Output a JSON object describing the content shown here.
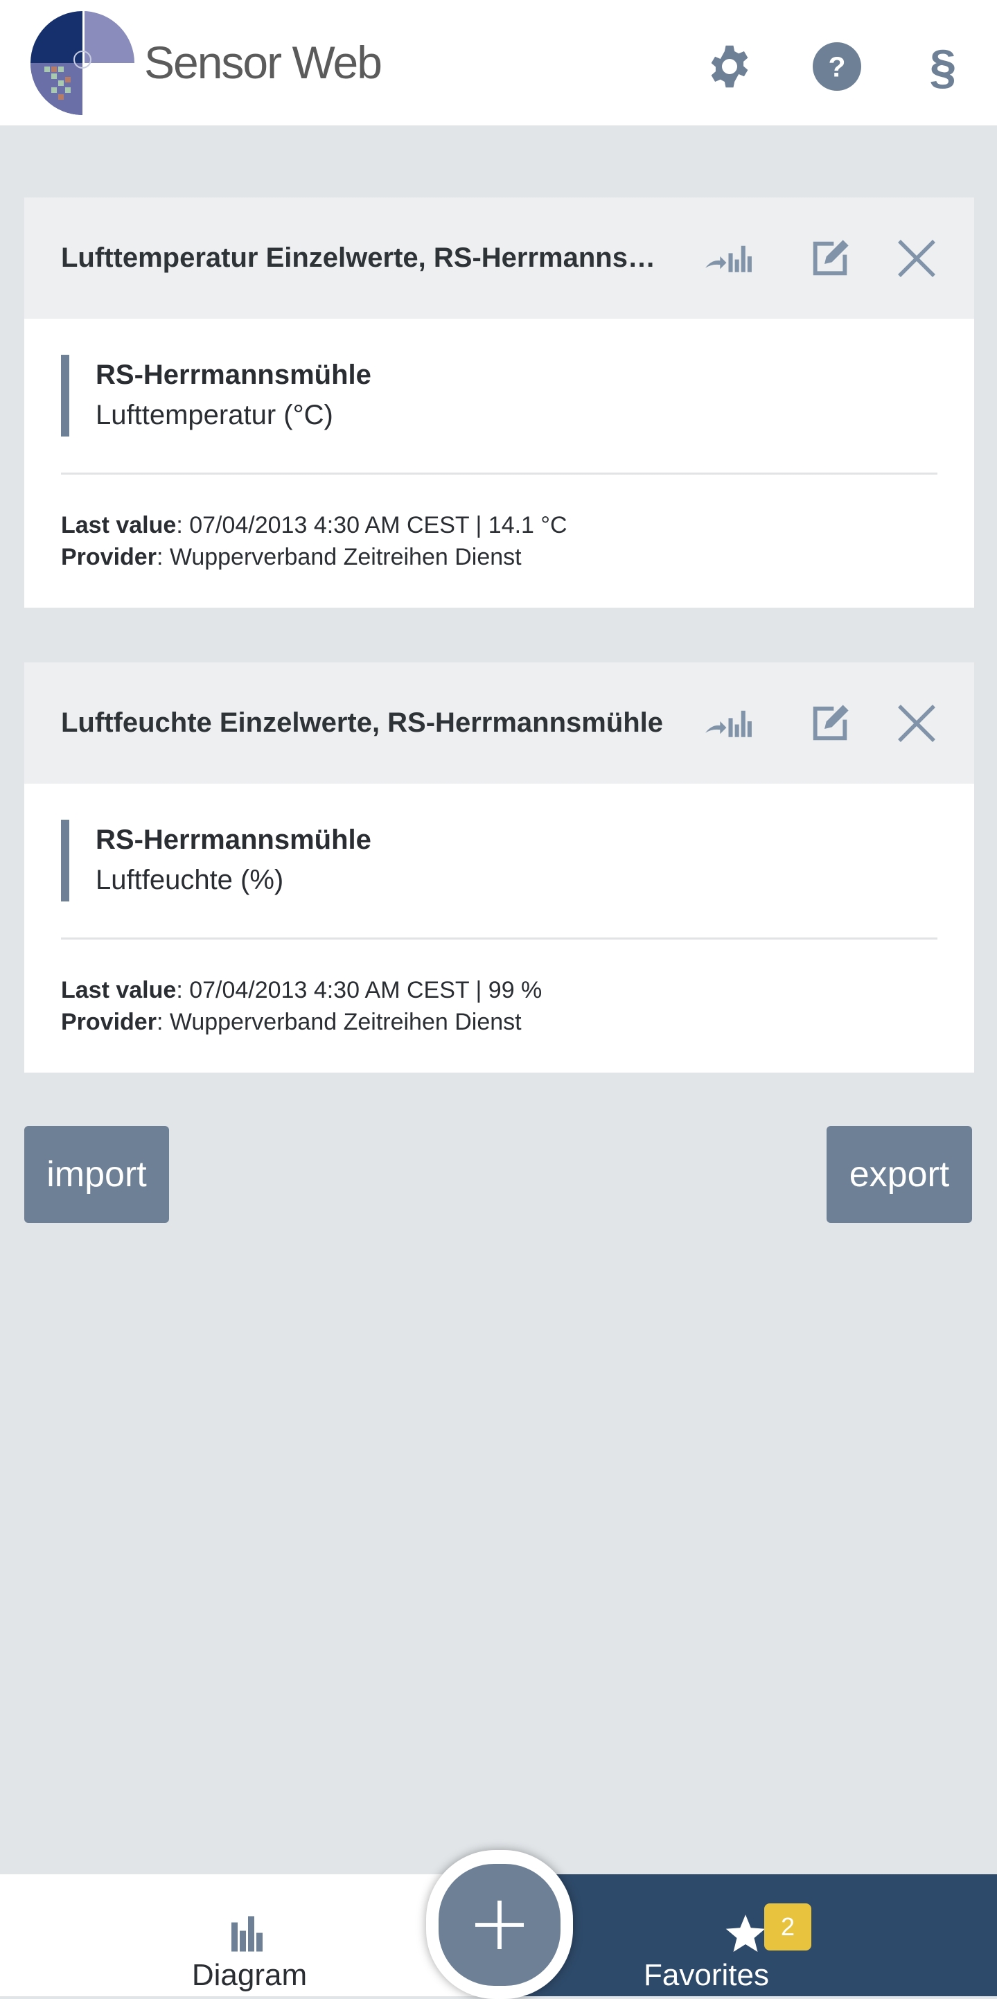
{
  "header": {
    "brand": "Sensor Web",
    "icons": [
      "gear-icon",
      "help-icon",
      "legal-section-icon"
    ]
  },
  "colors": {
    "accent": "#6e8096",
    "nav_dark": "#2e4a6a",
    "badge": "#e8c33e",
    "background": "#e1e5e8"
  },
  "cards": [
    {
      "title": "Lufttemperatur Einzelwerte, RS-Herrmannsmühle",
      "station": "RS-Herrmannsmühle",
      "phenomenon": "Lufttemperatur (°C)",
      "last_value_label": "Last value",
      "last_value": ": 07/04/2013 4:30 AM CEST | 14.1 °C",
      "provider_label": "Provider",
      "provider": ": Wupperverband Zeitreihen Dienst"
    },
    {
      "title": "Luftfeuchte Einzelwerte, RS-Herrmannsmühle",
      "station": "RS-Herrmannsmühle",
      "phenomenon": "Luftfeuchte (%)",
      "last_value_label": "Last value",
      "last_value": ": 07/04/2013 4:30 AM CEST | 99 %",
      "provider_label": "Provider",
      "provider": ": Wupperverband Zeitreihen Dienst"
    }
  ],
  "buttons": {
    "import": "import",
    "export": "export"
  },
  "bottom_nav": {
    "diagram": "Diagram",
    "favorites": "Favorites",
    "favorites_count": "2"
  }
}
